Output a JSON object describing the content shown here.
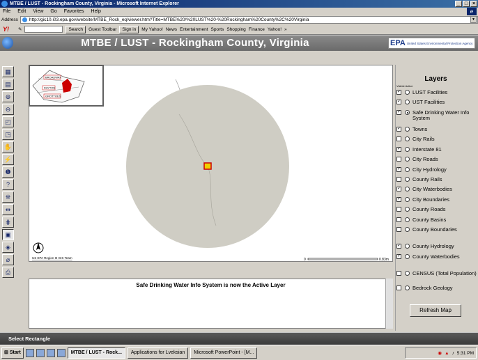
{
  "window": {
    "title": "MTBE / LUST - Rockingham County, Virginia - Microsoft Internet Explorer",
    "min": "_",
    "max": "□",
    "close": "×"
  },
  "menu": [
    "File",
    "Edit",
    "View",
    "Go",
    "Favorites",
    "Help"
  ],
  "address": {
    "label": "Address",
    "url": "http://gic10.i03.epa.gov/website/MTBE_Rock_eq/viewer.htm?Title=MTBE%20/%20LUST%20-%20Rockingham%20County%2C%20Virginia"
  },
  "yahoo": {
    "search_btn": "Search",
    "guest": "Guest Toolbar",
    "signin": "Sign in",
    "items": [
      "My Yahoo!",
      "News",
      "Entertainment",
      "Sports",
      "Shopping",
      "Finance",
      "Yahoo!"
    ],
    "more": "»"
  },
  "header": {
    "title": "MTBE / LUST - Rockingham County, Virginia",
    "epa_mark": "EPA",
    "epa_sub": "United States Environmental Protection Agency"
  },
  "tools": [
    {
      "name": "legend-icon",
      "glyph": "▦"
    },
    {
      "name": "overview-icon",
      "glyph": "▤"
    },
    {
      "name": "zoom-in-icon",
      "glyph": "⊕"
    },
    {
      "name": "zoom-out-icon",
      "glyph": "⊖"
    },
    {
      "name": "zoom-layer-icon",
      "glyph": "◰"
    },
    {
      "name": "zoom-extent-icon",
      "glyph": "◳"
    },
    {
      "name": "pan-icon",
      "glyph": "✋"
    },
    {
      "name": "zoom-active-icon",
      "glyph": "⚡"
    },
    {
      "name": "identify-icon",
      "glyph": "❶"
    },
    {
      "name": "query-icon",
      "glyph": "?"
    },
    {
      "name": "find-icon",
      "glyph": "⛯"
    },
    {
      "name": "measure-icon",
      "glyph": "⇹"
    },
    {
      "name": "select-line-icon",
      "glyph": "⋕"
    },
    {
      "name": "select-rectangle-icon",
      "glyph": "▣"
    },
    {
      "name": "buffer-icon",
      "glyph": "◈"
    },
    {
      "name": "clear-selection-icon",
      "glyph": "⌀"
    },
    {
      "name": "print-icon",
      "glyph": "⎙"
    }
  ],
  "map": {
    "overview_labels": [
      "BROADWAY",
      "DAYTON",
      "GROTTOES"
    ],
    "credit": "US EPA Region III GIS Team",
    "scale_start": "0",
    "scale_end": "0.83m",
    "buffer_color": "#cfcdc4",
    "feature_color": "#cc0000"
  },
  "message": "Safe Drinking Water Info System is now the Active Layer",
  "layers": {
    "title": "Layers",
    "col_visible": "Visible",
    "col_active": "Active",
    "items": [
      {
        "label": "LUST Facilities",
        "visible": true,
        "active": false
      },
      {
        "label": "UST Facilities",
        "visible": true,
        "active": false
      },
      {
        "label": "Safe Drinking Water Info System",
        "visible": true,
        "active": true
      },
      {
        "label": "Towns",
        "visible": true,
        "active": false
      },
      {
        "label": "City Rails",
        "visible": false,
        "active": false
      },
      {
        "label": "Interstate 81",
        "visible": true,
        "active": false
      },
      {
        "label": "City Roads",
        "visible": false,
        "active": false
      },
      {
        "label": "City Hydrology",
        "visible": true,
        "active": false
      },
      {
        "label": "County Rails",
        "visible": false,
        "active": false
      },
      {
        "label": "City Waterbodies",
        "visible": true,
        "active": false
      },
      {
        "label": "City Boundaries",
        "visible": true,
        "active": false
      },
      {
        "label": "County Roads",
        "visible": false,
        "active": false
      },
      {
        "label": "County Basins",
        "visible": false,
        "active": false
      },
      {
        "label": "County Boundaries",
        "visible": false,
        "active": false
      },
      {
        "label": "County Hydrology",
        "visible": true,
        "active": false
      },
      {
        "label": "County Waterbodies",
        "visible": true,
        "active": false
      },
      {
        "label": "CENSUS (Total Population)",
        "visible": false,
        "active": false
      },
      {
        "label": "Bedrock Geology",
        "visible": false,
        "active": false
      }
    ],
    "refresh": "Refresh Map"
  },
  "status": "Select Rectangle",
  "taskbar": {
    "start": "Start",
    "tasks": [
      {
        "label": "MTBE / LUST - Rock...",
        "active": true
      },
      {
        "label": "Applications for Lveksian",
        "active": false
      },
      {
        "label": "Microsoft PowerPoint - [M...",
        "active": false
      }
    ],
    "clock": "5:31 PM"
  }
}
